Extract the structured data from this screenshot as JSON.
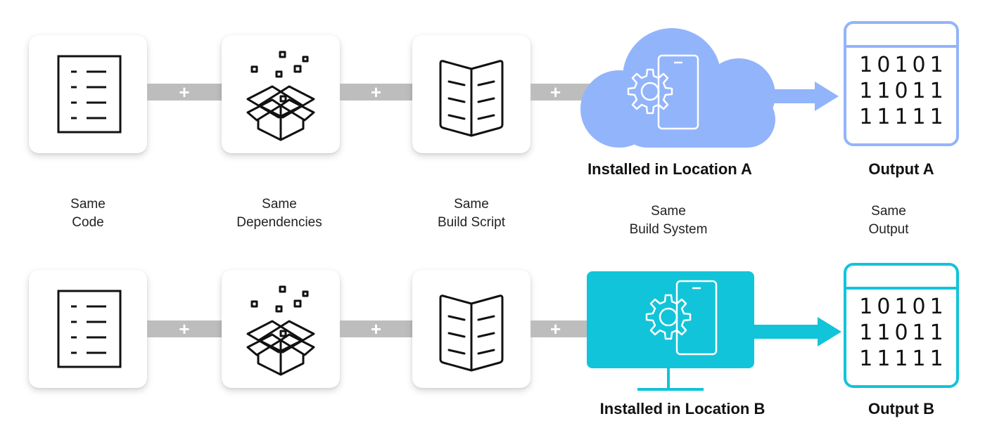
{
  "colors": {
    "location_a": "#92b4fb",
    "location_b": "#11c4d9",
    "connector": "#bdbdbd",
    "icon_stroke": "#111111"
  },
  "connector_symbol": "+",
  "rows": [
    {
      "steps": [
        {
          "icon": "code-document-icon"
        },
        {
          "icon": "dependencies-box-icon"
        },
        {
          "icon": "build-script-book-icon"
        }
      ],
      "system": {
        "shape": "cloud",
        "icon": "gear-phone-icon",
        "label": "Installed in Location A"
      },
      "output": {
        "label": "Output A",
        "bits": [
          "10101",
          "11011",
          "11111"
        ]
      }
    },
    {
      "steps": [
        {
          "icon": "code-document-icon"
        },
        {
          "icon": "dependencies-box-icon"
        },
        {
          "icon": "build-script-book-icon"
        }
      ],
      "system": {
        "shape": "monitor",
        "icon": "gear-phone-icon",
        "label": "Installed in Location B"
      },
      "output": {
        "label": "Output B",
        "bits": [
          "10101",
          "11011",
          "11111"
        ]
      }
    }
  ],
  "middle_labels": [
    {
      "line1": "Same",
      "line2": "Code"
    },
    {
      "line1": "Same",
      "line2": "Dependencies"
    },
    {
      "line1": "Same",
      "line2": "Build Script"
    },
    {
      "line1": "Same",
      "line2": "Build System"
    },
    {
      "line1": "Same",
      "line2": "Output"
    }
  ]
}
